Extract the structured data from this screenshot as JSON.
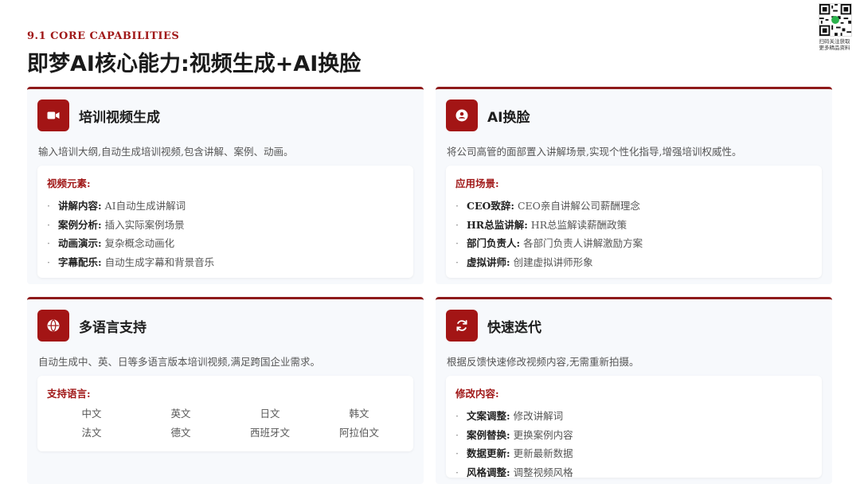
{
  "header": {
    "eyebrow": "9.1 CORE CAPABILITIES",
    "title": "即梦AI核心能力:视频生成+AI换脸"
  },
  "qr": {
    "caption_line1": "扫码关注获取",
    "caption_line2": "更多精品资料"
  },
  "colors": {
    "accent": "#a31515",
    "card_bg": "#f7f9fc",
    "top_border": "#8e1a1a"
  },
  "cards": [
    {
      "icon": "video-camera-icon",
      "title": "培训视频生成",
      "desc": "输入培训大纲,自动生成培训视频,包含讲解、案例、动画。",
      "label": "视频元素:",
      "items": [
        {
          "key": "讲解内容:",
          "value": " AI自动生成讲解词"
        },
        {
          "key": "案例分析:",
          "value": " 插入实际案例场景"
        },
        {
          "key": "动画演示:",
          "value": " 复杂概念动画化"
        },
        {
          "key": "字幕配乐:",
          "value": " 自动生成字幕和背景音乐"
        }
      ]
    },
    {
      "icon": "user-circle-icon",
      "title": "AI换脸",
      "desc": "将公司高管的面部置入讲解场景,实现个性化指导,增强培训权威性。",
      "label": "应用场景:",
      "items": [
        {
          "key": "CEO致辞:",
          "value": " CEO亲自讲解公司薪酬理念"
        },
        {
          "key": "HR总监讲解:",
          "value": " HR总监解读薪酬政策"
        },
        {
          "key": "部门负责人:",
          "value": " 各部门负责人讲解激励方案"
        },
        {
          "key": "虚拟讲师:",
          "value": " 创建虚拟讲师形象"
        }
      ]
    },
    {
      "icon": "globe-icon",
      "title": "多语言支持",
      "desc": "自动生成中、英、日等多语言版本培训视频,满足跨国企业需求。",
      "label": "支持语言:",
      "langs": [
        "中文",
        "英文",
        "日文",
        "韩文",
        "法文",
        "德文",
        "西班牙文",
        "阿拉伯文"
      ]
    },
    {
      "icon": "refresh-icon",
      "title": "快速迭代",
      "desc": "根据反馈快速修改视频内容,无需重新拍摄。",
      "label": "修改内容:",
      "items": [
        {
          "key": "文案调整:",
          "value": " 修改讲解词"
        },
        {
          "key": "案例替换:",
          "value": " 更换案例内容"
        },
        {
          "key": "数据更新:",
          "value": " 更新最新数据"
        },
        {
          "key": "风格调整:",
          "value": " 调整视频风格"
        }
      ]
    }
  ]
}
